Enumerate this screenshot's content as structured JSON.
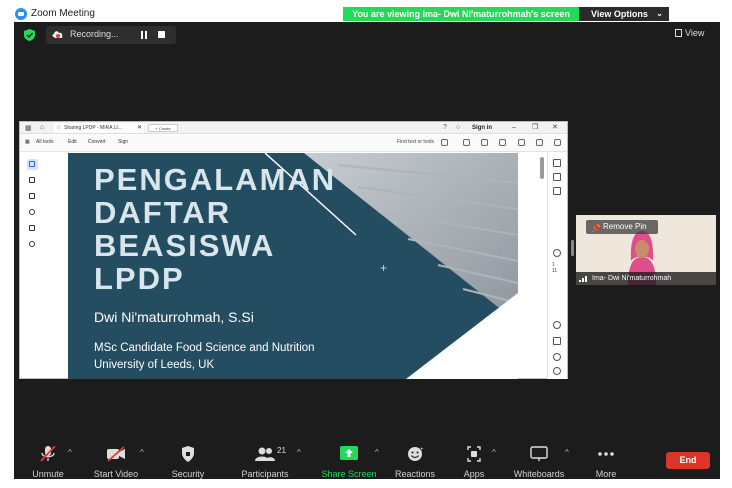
{
  "window": {
    "title": "Zoom Meeting",
    "viewing_banner": "You are viewing Ima- Dwi Ni'maturrohmah's screen",
    "view_options": "View Options"
  },
  "meeting": {
    "recording_label": "Recording...",
    "view_label": "View"
  },
  "shared_screen": {
    "tab_title": "Sharing LPDP - MIRA LI...",
    "new_tab": "+ Create",
    "sign_in": "Sign in",
    "menu": [
      "All tools",
      "Edit",
      "Convert",
      "Sign"
    ],
    "find_text": "Find text or tools",
    "slide": {
      "title_lines": [
        "PENGALAMAN",
        "DAFTAR",
        "BEASISWA",
        "LPDP"
      ],
      "author": "Dwi Ni'maturrohmah, S.Si",
      "subtitle_lines": [
        "MSc Candidate Food Science and Nutrition",
        "University of Leeds, UK"
      ]
    },
    "page_numbers": [
      "1",
      "11"
    ]
  },
  "participant": {
    "remove_pin": "Remove Pin",
    "name": "Ima- Dwi Ni'maturrohmah"
  },
  "controls": {
    "unmute": "Unmute",
    "start_video": "Start Video",
    "security": "Security",
    "participants": "Participants",
    "participants_count": "21",
    "share_screen": "Share Screen",
    "reactions": "Reactions",
    "apps": "Apps",
    "whiteboards": "Whiteboards",
    "more": "More",
    "end": "End"
  },
  "colors": {
    "zoom_blue": "#2d8cff",
    "banner_green": "#23d959",
    "slide_teal": "#244d62",
    "end_red": "#d9352b",
    "share_green": "#23d959"
  },
  "icons": [
    "zoom-logo-icon",
    "shield-icon",
    "record-icon",
    "pause-icon",
    "stop-icon",
    "view-icon",
    "pin-icon",
    "signal-icon",
    "mic-muted-icon",
    "video-off-icon",
    "security-shield-icon",
    "participants-icon",
    "share-screen-icon",
    "reactions-icon",
    "apps-icon",
    "whiteboard-icon",
    "more-icon"
  ]
}
